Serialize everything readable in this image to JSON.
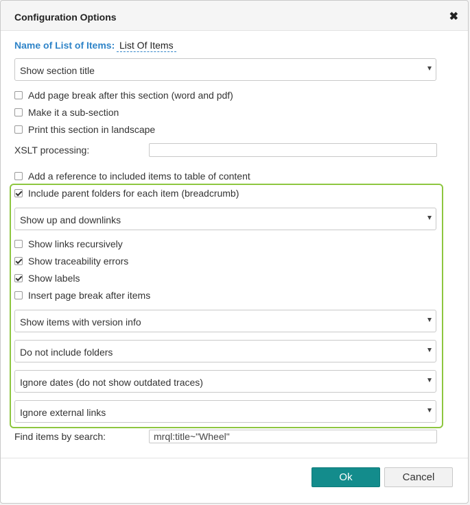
{
  "dialog": {
    "title": "Configuration Options",
    "close_glyph": "✖"
  },
  "name_field": {
    "label": "Name of List of Items:",
    "value": "List Of Items"
  },
  "section_title_select": "Show section title",
  "options_top": [
    {
      "label": "Add page break after this section (word and pdf)",
      "checked": false
    },
    {
      "label": "Make it a sub-section",
      "checked": false
    },
    {
      "label": "Print this section in landscape",
      "checked": false
    }
  ],
  "xslt": {
    "label": "XSLT processing:",
    "value": ""
  },
  "toc_option": {
    "label": "Add a reference to included items to table of content",
    "checked": false
  },
  "breadcrumb_option": {
    "label": "Include parent folders for each item (breadcrumb)",
    "checked": true
  },
  "links_select": "Show up and downlinks",
  "options_mid": [
    {
      "label": "Show links recursively",
      "checked": false
    },
    {
      "label": "Show traceability errors",
      "checked": true
    },
    {
      "label": "Show labels",
      "checked": true
    },
    {
      "label": "Insert page break after items",
      "checked": false
    }
  ],
  "selects_bottom": [
    "Show items with version info",
    "Do not include folders",
    "Ignore dates (do not show outdated traces)",
    "Ignore external links"
  ],
  "search_field": {
    "label": "Find items by search:",
    "value": "mrql:title~\"Wheel\""
  },
  "buttons": {
    "ok": "Ok",
    "cancel": "Cancel"
  },
  "colors": {
    "accent": "#2f84c8",
    "highlight_border": "#8dc63f",
    "ok_button": "#138c8c"
  }
}
